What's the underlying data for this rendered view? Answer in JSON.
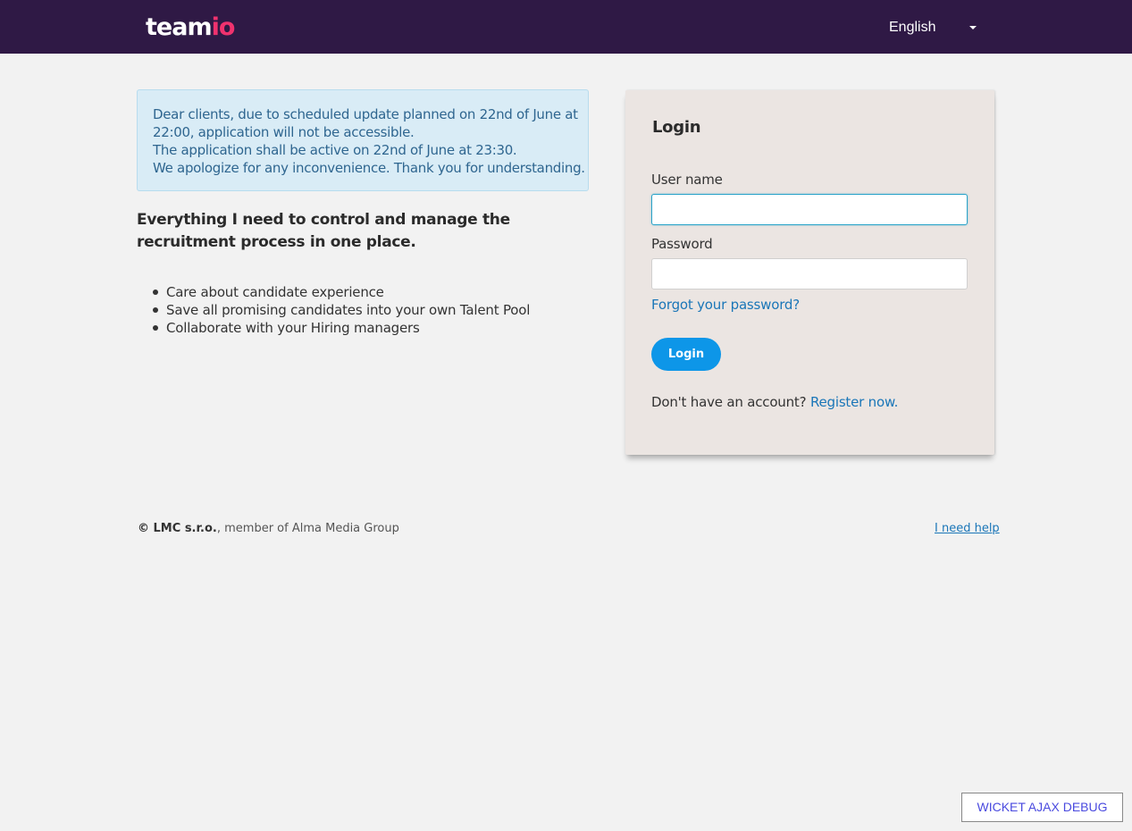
{
  "header": {
    "logo_main": "team",
    "logo_accent": "io",
    "language": "English",
    "accent_color": "#f0326e",
    "bar_color": "#2f1945"
  },
  "notice": {
    "lines": [
      "Dear clients, due to scheduled update planned on 22nd of June at",
      "22:00, application will not be accessible.",
      "The application shall be active on 22nd of June at 23:30.",
      "We apologize for any inconvenience. Thank you for understanding."
    ]
  },
  "intro": {
    "headline": "Everything I need to control and manage the recruitment process in one place.",
    "bullets": [
      "Care about candidate experience",
      "Save all promising candidates into your own Talent Pool",
      "Collaborate with your Hiring managers"
    ]
  },
  "login": {
    "title": "Login",
    "username_label": "User name",
    "username_value": "",
    "password_label": "Password",
    "password_value": "",
    "forgot_link": "Forgot your password?",
    "button_label": "Login",
    "no_account_text": "Don't have an account?",
    "register_link": "Register now."
  },
  "footer": {
    "company": "© LMC s.r.o.",
    "member_text": ", member of Alma Media Group",
    "help_link": "I need help"
  },
  "debug": {
    "label": "WICKET AJAX DEBUG"
  }
}
